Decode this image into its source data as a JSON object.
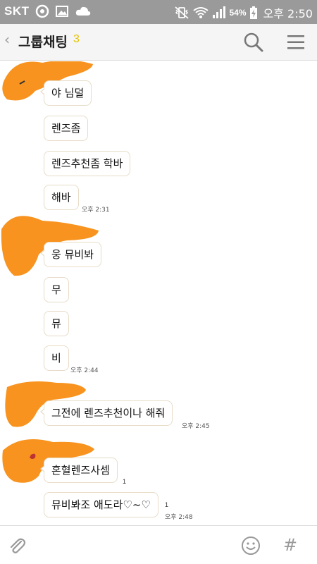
{
  "status_bar": {
    "carrier": "SKT",
    "battery": "54%",
    "clock": "오후 2:50",
    "icons": [
      "circle-notification-icon",
      "image-icon",
      "cloud-icon",
      "vibrate-mute-icon",
      "wifi-icon",
      "signal-icon",
      "battery-charging-icon"
    ]
  },
  "header": {
    "back_icon": "chevron-left-icon",
    "title": "그룹채팅",
    "member_count": "3",
    "actions": [
      "search-icon",
      "menu-icon"
    ]
  },
  "messages": [
    {
      "text": "야 님덜",
      "time": "",
      "unread": ""
    },
    {
      "text": "렌즈좀",
      "time": "",
      "unread": ""
    },
    {
      "text": "렌즈추천좀 학바",
      "time": "",
      "unread": ""
    },
    {
      "text": "해바",
      "time": "오후 2:31",
      "unread": ""
    },
    {
      "text": "웅 뮤비봐",
      "time": "",
      "unread": ""
    },
    {
      "text": "무",
      "time": "",
      "unread": ""
    },
    {
      "text": "뮤",
      "time": "",
      "unread": ""
    },
    {
      "text": "비",
      "time": "오후 2:44",
      "unread": ""
    },
    {
      "text": "그전에 렌즈추천이나 해줘",
      "time": "오후 2:45",
      "unread": ""
    },
    {
      "text": "혼혈렌즈사셈",
      "time": "",
      "unread": "1"
    },
    {
      "text": "뮤비봐조 애도라♡~♡",
      "time": "오후 2:48",
      "unread": "1"
    }
  ],
  "input_bar": {
    "attach_icon": "paperclip-icon",
    "emoji_icon": "smiley-icon",
    "hash_label": "#"
  },
  "colors": {
    "status_bar": "#9a9a9a",
    "header_bg": "#f5f5f5",
    "member_count": "#e6c100",
    "bubble_border": "#e8dcc8",
    "scribble": "#f7931e"
  }
}
